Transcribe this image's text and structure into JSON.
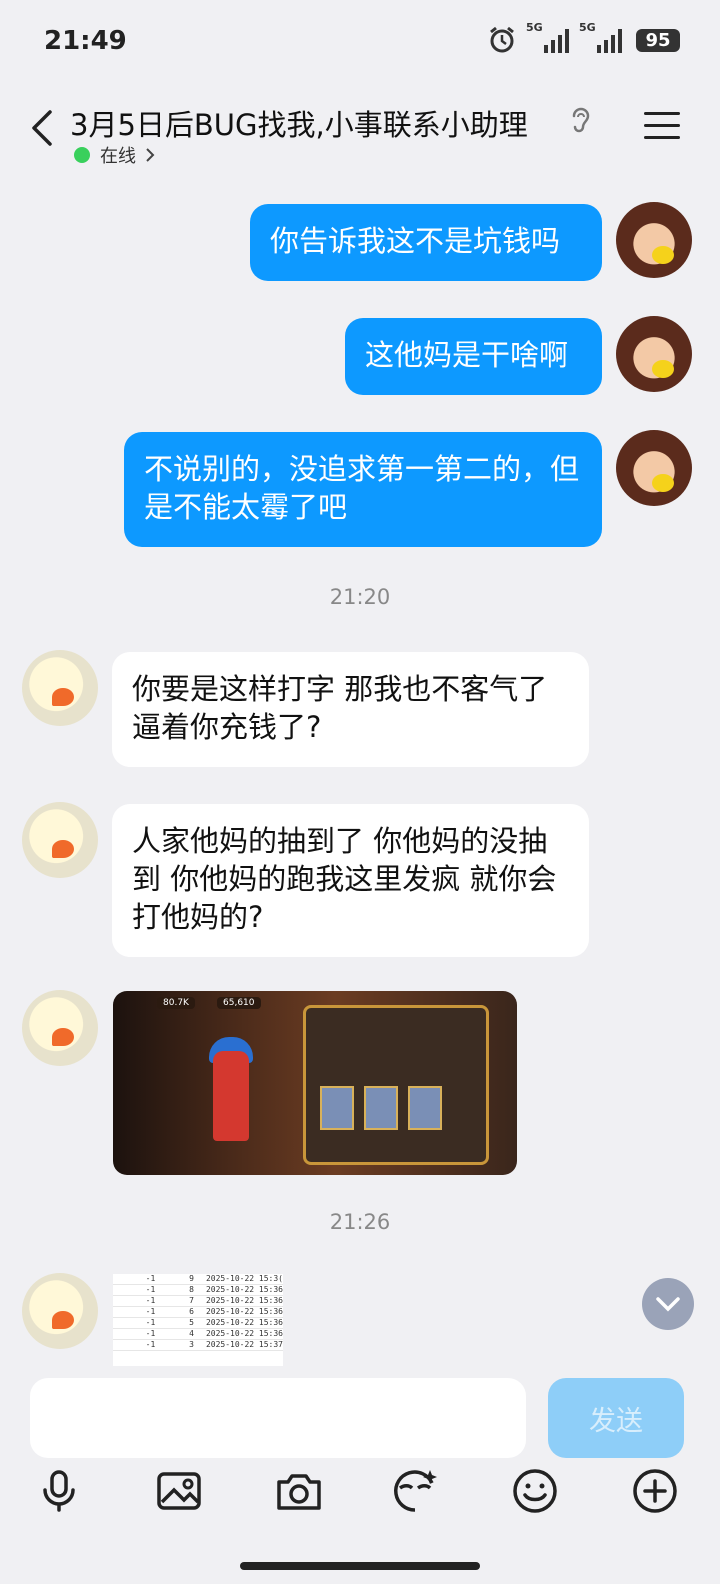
{
  "status_bar": {
    "time": "21:49",
    "signal1_label": "5G",
    "signal2_label": "5G",
    "battery": "95",
    "alarm_icon": "alarm-icon"
  },
  "header": {
    "title": "3月5日后BUG找我,小事联系小助理",
    "online_status": "在线",
    "back_icon": "chevron-left-icon",
    "menu_icon": "menu-icon",
    "ear_icon": "ear-icon"
  },
  "messages": [
    {
      "side": "me",
      "text": "你告诉我这不是坑钱吗"
    },
    {
      "side": "me",
      "text": "这他妈是干啥啊"
    },
    {
      "side": "me",
      "text": "不说别的，没追求第一第二的，但是不能太霉了吧"
    },
    {
      "side": "other",
      "text": "你要是这样打字 那我也不客气了  逼着你充钱了?"
    },
    {
      "side": "other",
      "text": "人家他妈的抽到了 你他妈的没抽到 你他妈的跑我这里发疯  就你会打他妈的?"
    }
  ],
  "time_labels": [
    "21:20",
    "21:26"
  ],
  "image_message": {
    "coins": "80.7K",
    "gems": "65,610"
  },
  "table_message": {
    "rows": [
      [
        "-1",
        "9",
        "2025-10-22 15:3("
      ],
      [
        "-1",
        "8",
        "2025-10-22 15:36"
      ],
      [
        "-1",
        "7",
        "2025-10-22 15:36"
      ],
      [
        "-1",
        "6",
        "2025-10-22 15:36"
      ],
      [
        "-1",
        "5",
        "2025-10-22 15:36"
      ],
      [
        "-1",
        "4",
        "2025-10-22 15:36"
      ],
      [
        "-1",
        "3",
        "2025-10-22 15:37"
      ]
    ]
  },
  "input": {
    "placeholder": "",
    "send_label": "发送"
  },
  "toolbar": {
    "icons": [
      "microphone-icon",
      "image-icon",
      "camera-icon",
      "sticker-face-icon",
      "emoji-icon",
      "plus-circle-icon"
    ]
  },
  "colors": {
    "my_bubble": "#0d99ff",
    "other_bubble": "#ffffff",
    "send_button": "#8ecef8",
    "online_dot": "#39d05c"
  }
}
